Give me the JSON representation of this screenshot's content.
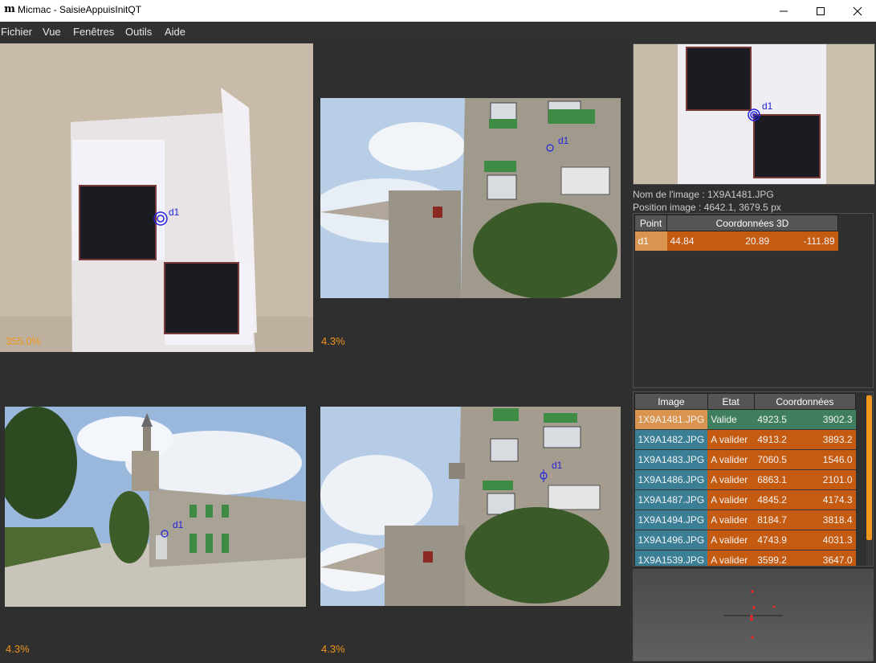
{
  "window": {
    "title": "Micmac - SaisieAppuisInitQT",
    "logo": "m"
  },
  "menu": [
    "Fichier",
    "Vue",
    "Fenêtres",
    "Outils",
    "Aide"
  ],
  "views": [
    {
      "zoom": "355.0%",
      "point_label": "d1"
    },
    {
      "zoom": "4.3%",
      "point_label": "d1"
    },
    {
      "zoom": "4.3%",
      "point_label": "d1"
    },
    {
      "zoom": "4.3%",
      "point_label": "d1"
    }
  ],
  "zoom_window": {
    "point_label": "d1"
  },
  "info": {
    "image_name": "Nom de l'image : 1X9A1481.JPG",
    "image_position": "Position image : 4642.1, 3679.5 px"
  },
  "points_table": {
    "headers": [
      "Point",
      "Coordonnées 3D"
    ],
    "rows": [
      {
        "point": "d1",
        "x": "44.84",
        "y": "20.89",
        "z": "-111.89"
      }
    ]
  },
  "images_table": {
    "headers": [
      "Image",
      "Etat",
      "Coordonnées"
    ],
    "rows": [
      {
        "image": "1X9A1481.JPG",
        "state": "Valide",
        "x": "4923.5",
        "y": "3902.3"
      },
      {
        "image": "1X9A1482.JPG",
        "state": "A valider",
        "x": "4913.2",
        "y": "3893.2"
      },
      {
        "image": "1X9A1483.JPG",
        "state": "A valider",
        "x": "7060.5",
        "y": "1546.0"
      },
      {
        "image": "1X9A1486.JPG",
        "state": "A valider",
        "x": "6863.1",
        "y": "2101.0"
      },
      {
        "image": "1X9A1487.JPG",
        "state": "A valider",
        "x": "4845.2",
        "y": "4174.3"
      },
      {
        "image": "1X9A1494.JPG",
        "state": "A valider",
        "x": "8184.7",
        "y": "3818.4"
      },
      {
        "image": "1X9A1496.JPG",
        "state": "A valider",
        "x": "4743.9",
        "y": "4031.3"
      },
      {
        "image": "1X9A1539.JPG",
        "state": "A valider",
        "x": "3599.2",
        "y": "3647.0"
      }
    ]
  },
  "colors": {
    "accent_orange": "#c55a11",
    "valid_green": "#3f7f5f",
    "image_blue": "#3a7f96",
    "image_selected": "#d9944f",
    "zoom_text": "#f0961e"
  }
}
